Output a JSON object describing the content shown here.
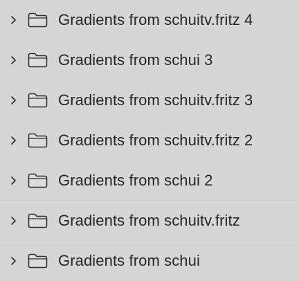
{
  "folders": {
    "items": [
      {
        "label": "Gradients from schuitv.fritz 4"
      },
      {
        "label": "Gradients from schui 3"
      },
      {
        "label": "Gradients from schuitv.fritz 3"
      },
      {
        "label": "Gradients from schuitv.fritz 2"
      },
      {
        "label": "Gradients from schui 2"
      },
      {
        "label": "Gradients from schuitv.fritz"
      },
      {
        "label": "Gradients from schui"
      }
    ]
  },
  "icons": {
    "disclosure": "chevron-right-icon",
    "folder": "folder-icon"
  },
  "colors": {
    "background": "#d6d6d6",
    "text": "#262626",
    "icon": "#2b2b2b"
  }
}
